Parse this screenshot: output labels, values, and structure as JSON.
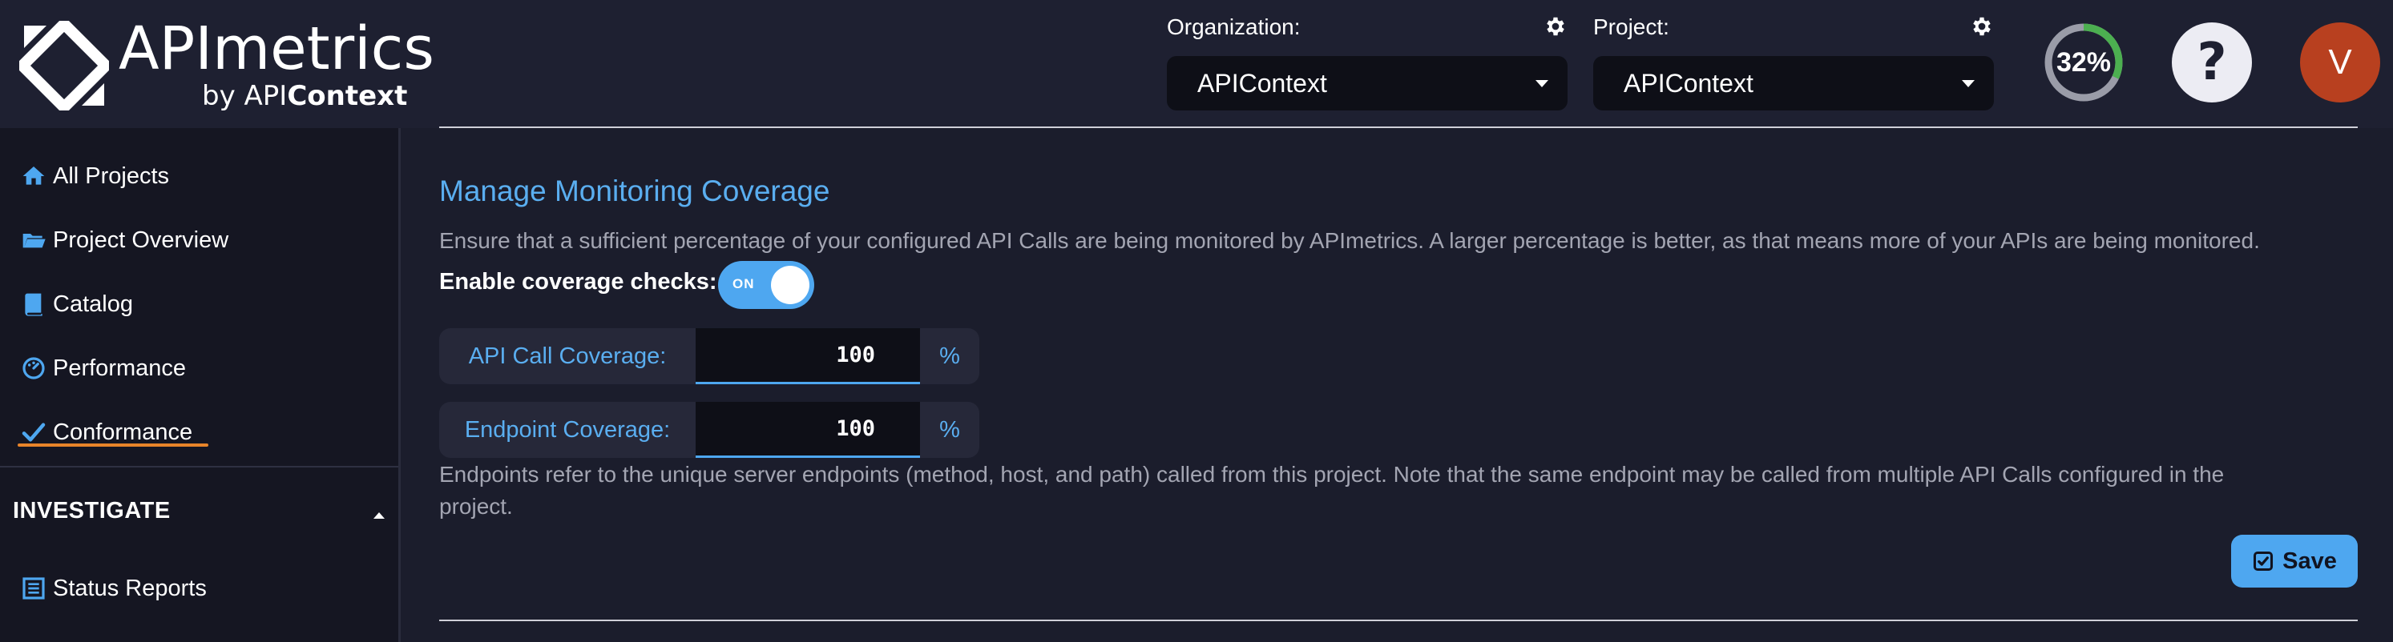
{
  "header": {
    "logo": {
      "name": "APImetrics",
      "sub_prefix": "by API",
      "sub_brand": "Context"
    },
    "organization": {
      "label": "Organization:",
      "value": "APIContext"
    },
    "project": {
      "label": "Project:",
      "value": "APIContext"
    },
    "progress": {
      "text": "32%",
      "fraction": 0.32
    },
    "help_label": "?",
    "avatar_initial": "V"
  },
  "sidebar": {
    "items": [
      {
        "label": "All Projects",
        "icon": "home-icon"
      },
      {
        "label": "Project Overview",
        "icon": "folder-open-icon"
      },
      {
        "label": "Catalog",
        "icon": "book-icon"
      },
      {
        "label": "Performance",
        "icon": "dashboard-icon"
      },
      {
        "label": "Conformance",
        "icon": "check-icon",
        "active": true
      }
    ],
    "section": {
      "title": "INVESTIGATE",
      "expanded": true
    },
    "section_items": [
      {
        "label": "Status Reports",
        "icon": "list-icon"
      }
    ]
  },
  "main": {
    "title": "Manage Monitoring Coverage",
    "description": "Ensure that a sufficient percentage of your configured API Calls are being monitored by APImetrics. A larger percentage is better, as that means more of your APIs are being monitored.",
    "coverage_checks": {
      "label": "Enable coverage checks:",
      "toggle_text": "ON",
      "enabled": true
    },
    "api_call_coverage": {
      "label": "API Call Coverage:",
      "value": "100",
      "unit": "%"
    },
    "endpoint_coverage": {
      "label": "Endpoint Coverage:",
      "value": "100",
      "unit": "%"
    },
    "note_line1": "Endpoints refer to the unique server endpoints (method, host, and path) called from this project. Note that the same endpoint may be called from multiple API Calls configured in the",
    "note_line2": "project.",
    "save_label": "Save"
  },
  "colors": {
    "accent": "#4ea7f0",
    "title": "#5aaef0",
    "active_underline": "#e8842a",
    "progress_green": "#4caf50",
    "avatar": "#b8401f"
  }
}
